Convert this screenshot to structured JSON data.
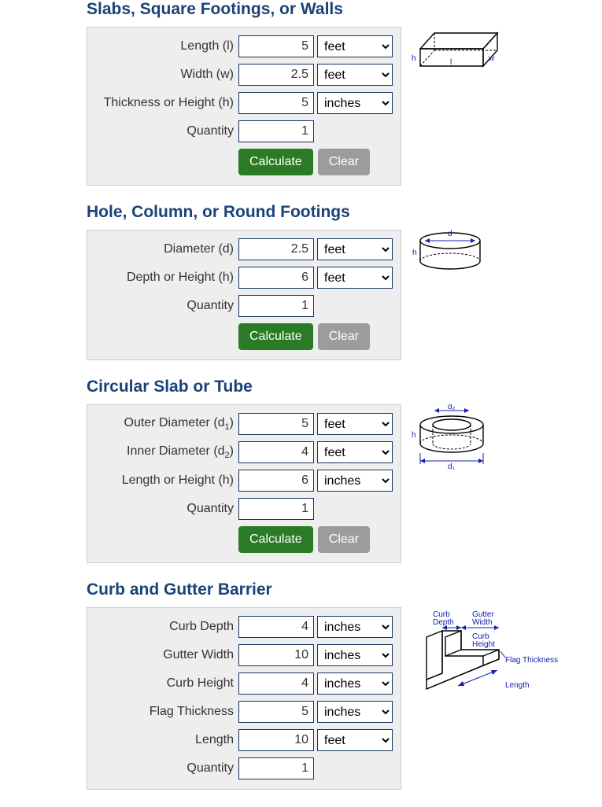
{
  "buttons": {
    "calculate": "Calculate",
    "clear": "Clear"
  },
  "units": {
    "feet": "feet",
    "inches": "inches"
  },
  "slab": {
    "heading": "Slabs, Square Footings, or Walls",
    "length_label": "Length (l)",
    "length_value": "5",
    "length_unit": "feet",
    "width_label": "Width (w)",
    "width_value": "2.5",
    "width_unit": "feet",
    "thickness_label": "Thickness or Height (h)",
    "thickness_value": "5",
    "thickness_unit": "inches",
    "quantity_label": "Quantity",
    "quantity_value": "1",
    "diag": {
      "h": "h",
      "l": "l",
      "w": "w"
    }
  },
  "hole": {
    "heading": "Hole, Column, or Round Footings",
    "diameter_label": "Diameter (d)",
    "diameter_value": "2.5",
    "diameter_unit": "feet",
    "depth_label": "Depth or Height (h)",
    "depth_value": "6",
    "depth_unit": "feet",
    "quantity_label": "Quantity",
    "quantity_value": "1",
    "diag": {
      "h": "h",
      "d": "d"
    }
  },
  "tube": {
    "heading": "Circular Slab or Tube",
    "outer_label_pre": "Outer Diameter (d",
    "outer_label_sub": "1",
    "outer_label_post": ")",
    "outer_value": "5",
    "outer_unit": "feet",
    "inner_label_pre": "Inner Diameter (d",
    "inner_label_sub": "2",
    "inner_label_post": ")",
    "inner_value": "4",
    "inner_unit": "feet",
    "length_label": "Length or Height (h)",
    "length_value": "6",
    "length_unit": "inches",
    "quantity_label": "Quantity",
    "quantity_value": "1",
    "diag": {
      "h": "h",
      "d1": "d₁",
      "d2": "d₂"
    }
  },
  "curb": {
    "heading": "Curb and Gutter Barrier",
    "curb_depth_label": "Curb Depth",
    "curb_depth_value": "4",
    "curb_depth_unit": "inches",
    "gutter_width_label": "Gutter Width",
    "gutter_width_value": "10",
    "gutter_width_unit": "inches",
    "curb_height_label": "Curb Height",
    "curb_height_value": "4",
    "curb_height_unit": "inches",
    "flag_thickness_label": "Flag Thickness",
    "flag_thickness_value": "5",
    "flag_thickness_unit": "inches",
    "length_label": "Length",
    "length_value": "10",
    "length_unit": "feet",
    "quantity_label": "Quantity",
    "quantity_value": "1",
    "diag": {
      "curb_depth": "Curb\nDepth",
      "gutter_width": "Gutter\nWidth",
      "curb_height": "Curb\nHeight",
      "flag_thickness": "Flag Thickness",
      "length": "Length"
    }
  }
}
